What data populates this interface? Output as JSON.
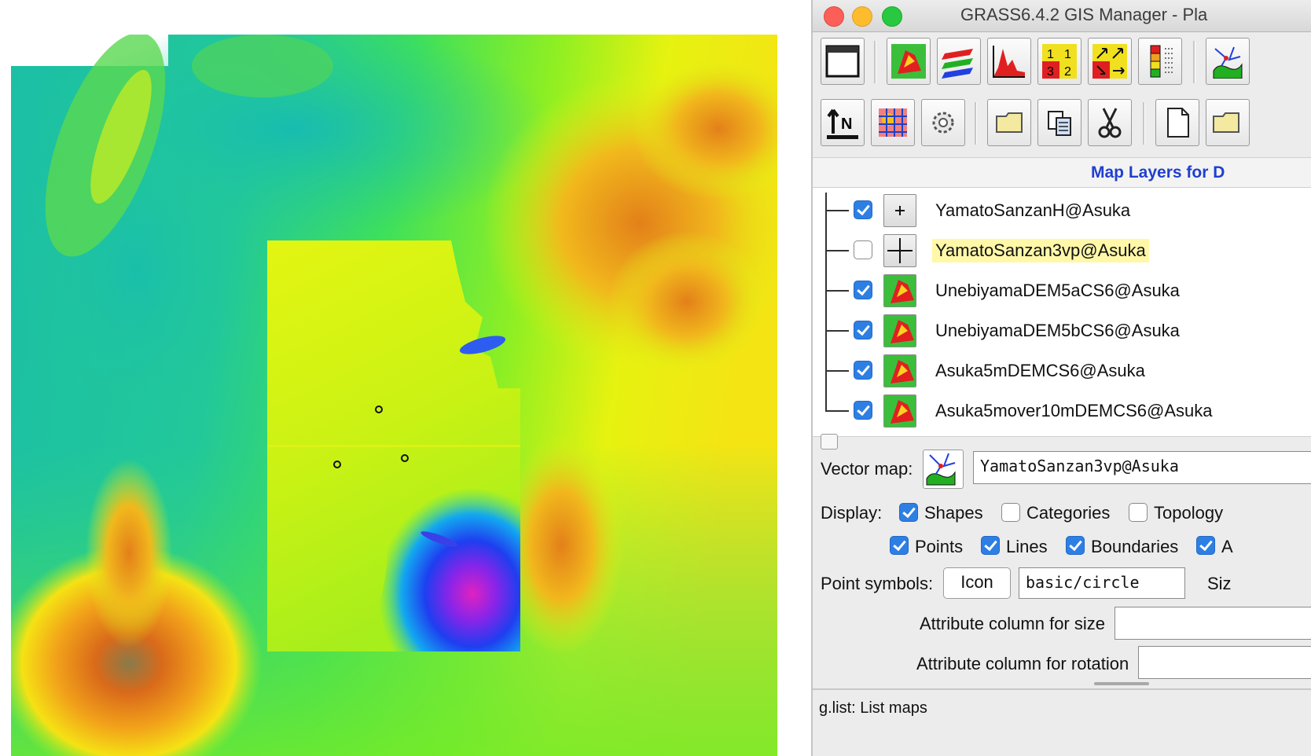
{
  "window": {
    "title": "GRASS6.4.2 GIS Manager - Pla"
  },
  "toolbar": {
    "row1": [
      "new-display-icon",
      "add-raster-icon",
      "add-raster-layers-icon",
      "histogram-icon",
      "legend-numbers-icon",
      "rgb-overlay-icon",
      "legend-bar-icon",
      "add-vector-icon"
    ],
    "row2": [
      "north-arrow-icon",
      "grid-icon",
      "gear-icon",
      "open-folder-icon",
      "copy-icon",
      "cut-icon",
      "new-file-icon",
      "open-file-icon"
    ]
  },
  "layers": {
    "header": "Map Layers for D",
    "items": [
      {
        "name": "YamatoSanzanH@Asuka",
        "checked": true,
        "type": "vector-plus",
        "selected": false
      },
      {
        "name": "YamatoSanzan3vp@Asuka",
        "checked": false,
        "type": "vector-cross",
        "selected": true
      },
      {
        "name": "UnebiyamaDEM5aCS6@Asuka",
        "checked": true,
        "type": "raster",
        "selected": false
      },
      {
        "name": "UnebiyamaDEM5bCS6@Asuka",
        "checked": true,
        "type": "raster",
        "selected": false
      },
      {
        "name": "Asuka5mDEMCS6@Asuka",
        "checked": true,
        "type": "raster",
        "selected": false
      },
      {
        "name": "Asuka5mover10mDEMCS6@Asuka",
        "checked": true,
        "type": "raster",
        "selected": false
      }
    ]
  },
  "vector_props": {
    "vector_map_label": "Vector map:",
    "vector_map_value": "YamatoSanzan3vp@Asuka",
    "display_label": "Display:",
    "shapes": {
      "label": "Shapes",
      "checked": true
    },
    "categories": {
      "label": "Categories",
      "checked": false
    },
    "topology": {
      "label": "Topology",
      "checked": false
    },
    "points": {
      "label": "Points",
      "checked": true
    },
    "lines": {
      "label": "Lines",
      "checked": true
    },
    "boundaries": {
      "label": "Boundaries",
      "checked": true
    },
    "areas": {
      "label": "A",
      "checked": true
    },
    "point_symbols_label": "Point symbols:",
    "icon_button": "Icon",
    "symbol_value": "basic/circle",
    "size_label": "Siz",
    "attr_size_label": "Attribute column for size",
    "attr_rotation_label": "Attribute column for rotation"
  },
  "status": {
    "text": "g.list: List maps"
  },
  "map": {
    "points_count": 3
  }
}
